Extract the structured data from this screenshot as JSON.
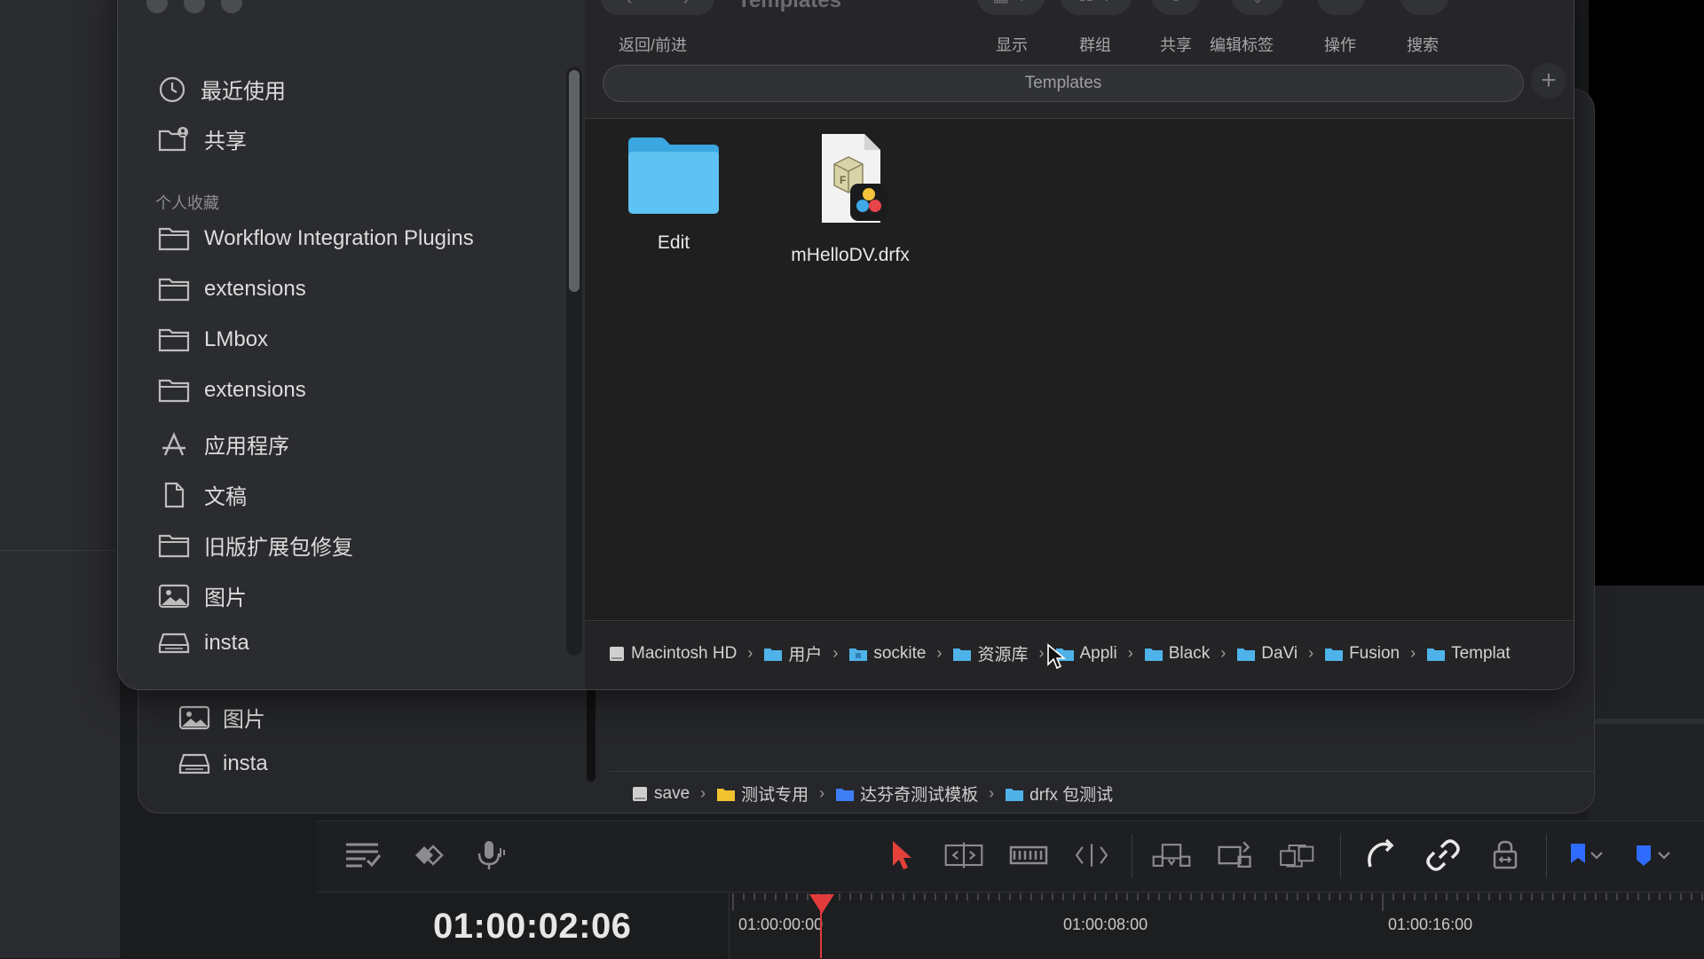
{
  "front_dialog": {
    "title": "Templates",
    "nav": {
      "back_forward_label": "返回/前进"
    },
    "toolbar": {
      "view_label": "显示",
      "group_label": "群组",
      "share_label": "共享",
      "tags_label": "编辑标签",
      "action_label": "操作",
      "search_label": "搜索"
    },
    "path_field": "Templates",
    "sidebar": {
      "top_items": [
        {
          "label": "最近使用",
          "icon": "clock-icon"
        },
        {
          "label": "共享",
          "icon": "shared-folder-icon"
        }
      ],
      "section_title": "个人收藏",
      "items": [
        {
          "label": "Workflow Integration Plugins",
          "icon": "folder-icon"
        },
        {
          "label": "extensions",
          "icon": "folder-icon"
        },
        {
          "label": "LMbox",
          "icon": "folder-icon"
        },
        {
          "label": "extensions",
          "icon": "folder-icon"
        },
        {
          "label": "应用程序",
          "icon": "apps-icon"
        },
        {
          "label": "文稿",
          "icon": "document-icon"
        },
        {
          "label": "旧版扩展包修复",
          "icon": "folder-icon"
        },
        {
          "label": "图片",
          "icon": "photo-icon"
        },
        {
          "label": "insta",
          "icon": "drive-icon"
        }
      ]
    },
    "files": [
      {
        "name": "Edit",
        "icon": "folder-icon"
      },
      {
        "name": "mHelloDV.drfx",
        "icon": "drfx-file-icon"
      }
    ],
    "breadcrumbs": [
      "Macintosh HD",
      "用户",
      "sockite",
      "资源库",
      "Appli",
      "Black",
      "DaVi",
      "Fusion",
      "Templat"
    ]
  },
  "back_dialog": {
    "sidebar_items": [
      {
        "label": "图片",
        "icon": "photo-icon"
      },
      {
        "label": "insta",
        "icon": "drive-icon"
      }
    ],
    "breadcrumbs": [
      "save",
      "测试专用",
      "达芬奇测试模板",
      "drfx 包测试"
    ]
  },
  "timeline": {
    "timecode": "01:00:02:06",
    "ruler_labels": [
      "01:00:00:00",
      "01:00:08:00",
      "01:00:16:00"
    ],
    "colors": {
      "playhead": "#e23b3b",
      "accent_red": "#e5413b",
      "flag_blue": "#2f6bff"
    }
  }
}
